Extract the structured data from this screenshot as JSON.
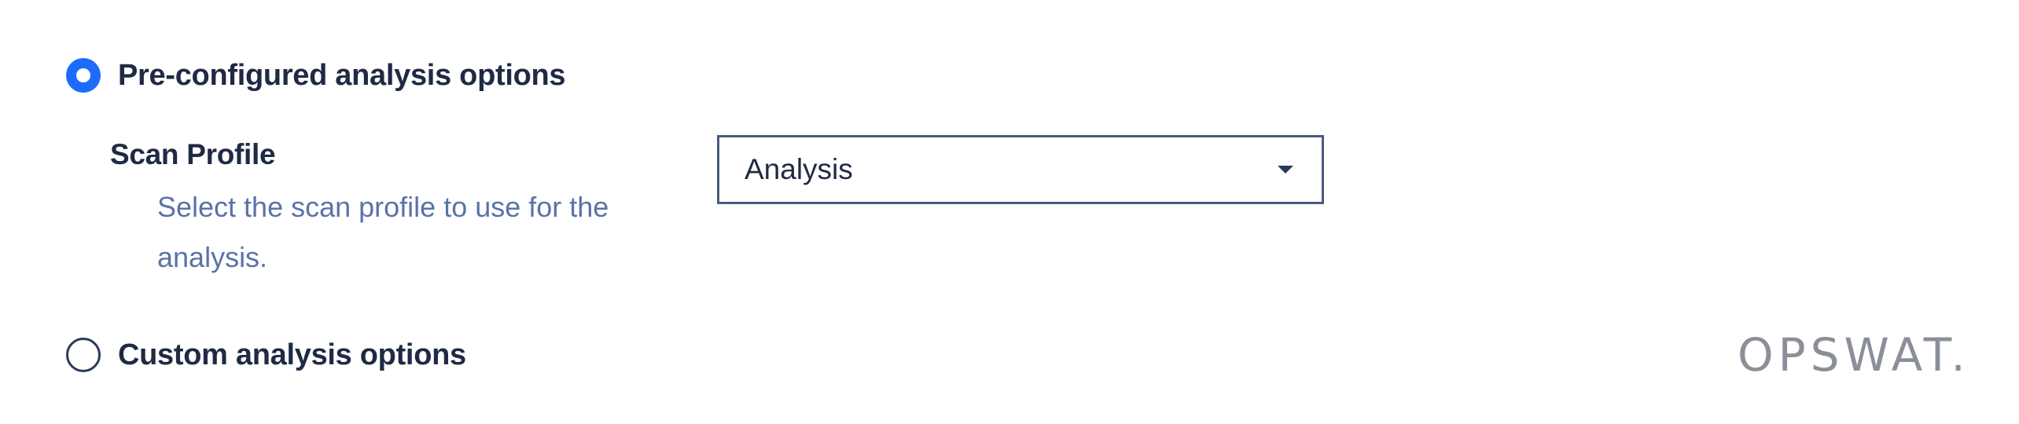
{
  "options": {
    "preconfigured": {
      "label": "Pre-configured analysis options",
      "selected": true
    },
    "custom": {
      "label": "Custom analysis options",
      "selected": false
    }
  },
  "scan_profile": {
    "label": "Scan Profile",
    "help": "Select the scan profile to use for the analysis.",
    "value": "Analysis"
  },
  "branding": {
    "logo_text": "OPSWAT."
  },
  "colors": {
    "accent": "#1d6bfc",
    "text": "#1f2a44",
    "help_text": "#5b72a8",
    "logo": "#8a8f99"
  },
  "icons": {
    "select_caret": "chevron-down-icon"
  }
}
